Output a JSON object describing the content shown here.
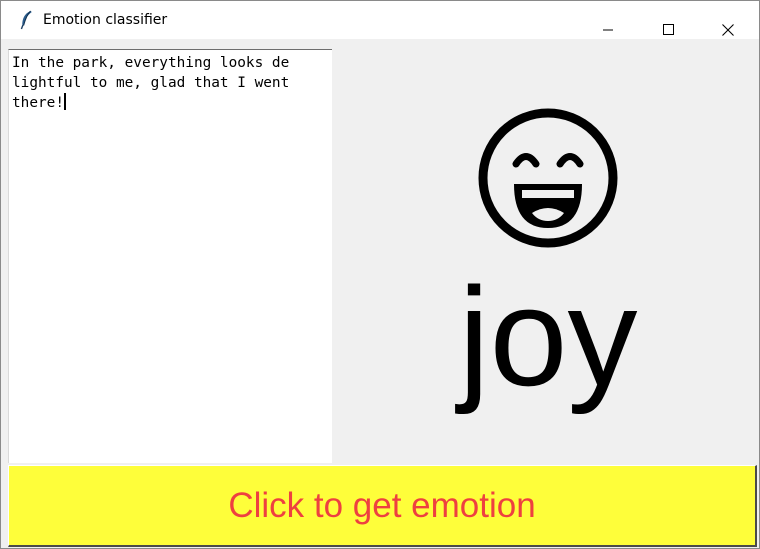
{
  "window": {
    "title": "Emotion classifier",
    "app_icon": "feather-icon",
    "controls": [
      "minimize-icon",
      "maximize-icon",
      "close-icon"
    ]
  },
  "input": {
    "lines": [
      "In the park, everything looks de",
      "lightful to me, glad that I went",
      "there!"
    ]
  },
  "output": {
    "emoji_icon": "grinning-face-smiling-eyes-icon",
    "emotion": "joy"
  },
  "button": {
    "label": "Click to get emotion"
  },
  "colors": {
    "button_background": "#fefe3a",
    "button_text": "#ee4040",
    "panel_background": "#f0f0f0",
    "text_background": "#ffffff"
  }
}
